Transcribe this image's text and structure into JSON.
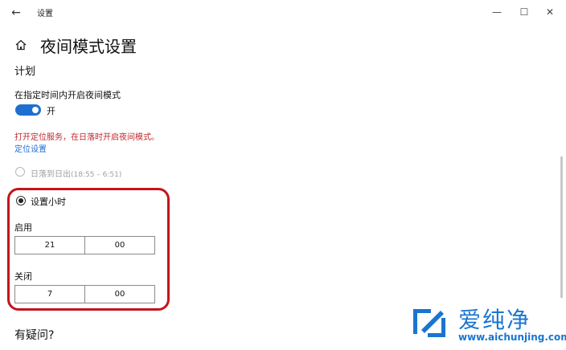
{
  "window": {
    "title": "设置",
    "back_icon": "←",
    "minimize_icon": "—",
    "maximize_icon": "☐",
    "close_icon": "✕"
  },
  "header": {
    "title": "夜间模式设置",
    "home_icon": "home-icon"
  },
  "schedule": {
    "section_title": "计划",
    "toggle_label": "在指定时间内开启夜间模式",
    "toggle_state": "开",
    "toggle_on": true,
    "warning_text": "打开定位服务，在日落时开启夜间模式。",
    "location_link": "定位设置",
    "options": [
      {
        "label": "日落到日出",
        "detail": "(18:55 – 6:51)",
        "selected": false,
        "disabled": true
      },
      {
        "label": "设置小时",
        "selected": true
      }
    ],
    "start": {
      "label": "启用",
      "hour": "21",
      "minute": "00"
    },
    "end": {
      "label": "关闭",
      "hour": "7",
      "minute": "00"
    }
  },
  "help": {
    "title": "有疑问?"
  },
  "watermark": {
    "text": "爱纯净",
    "url": "www.aichunjing.com"
  },
  "colors": {
    "accent": "#1f6fd1",
    "warning": "#c0272d",
    "highlight": "#c4151c",
    "watermark": "#1a75d1"
  }
}
